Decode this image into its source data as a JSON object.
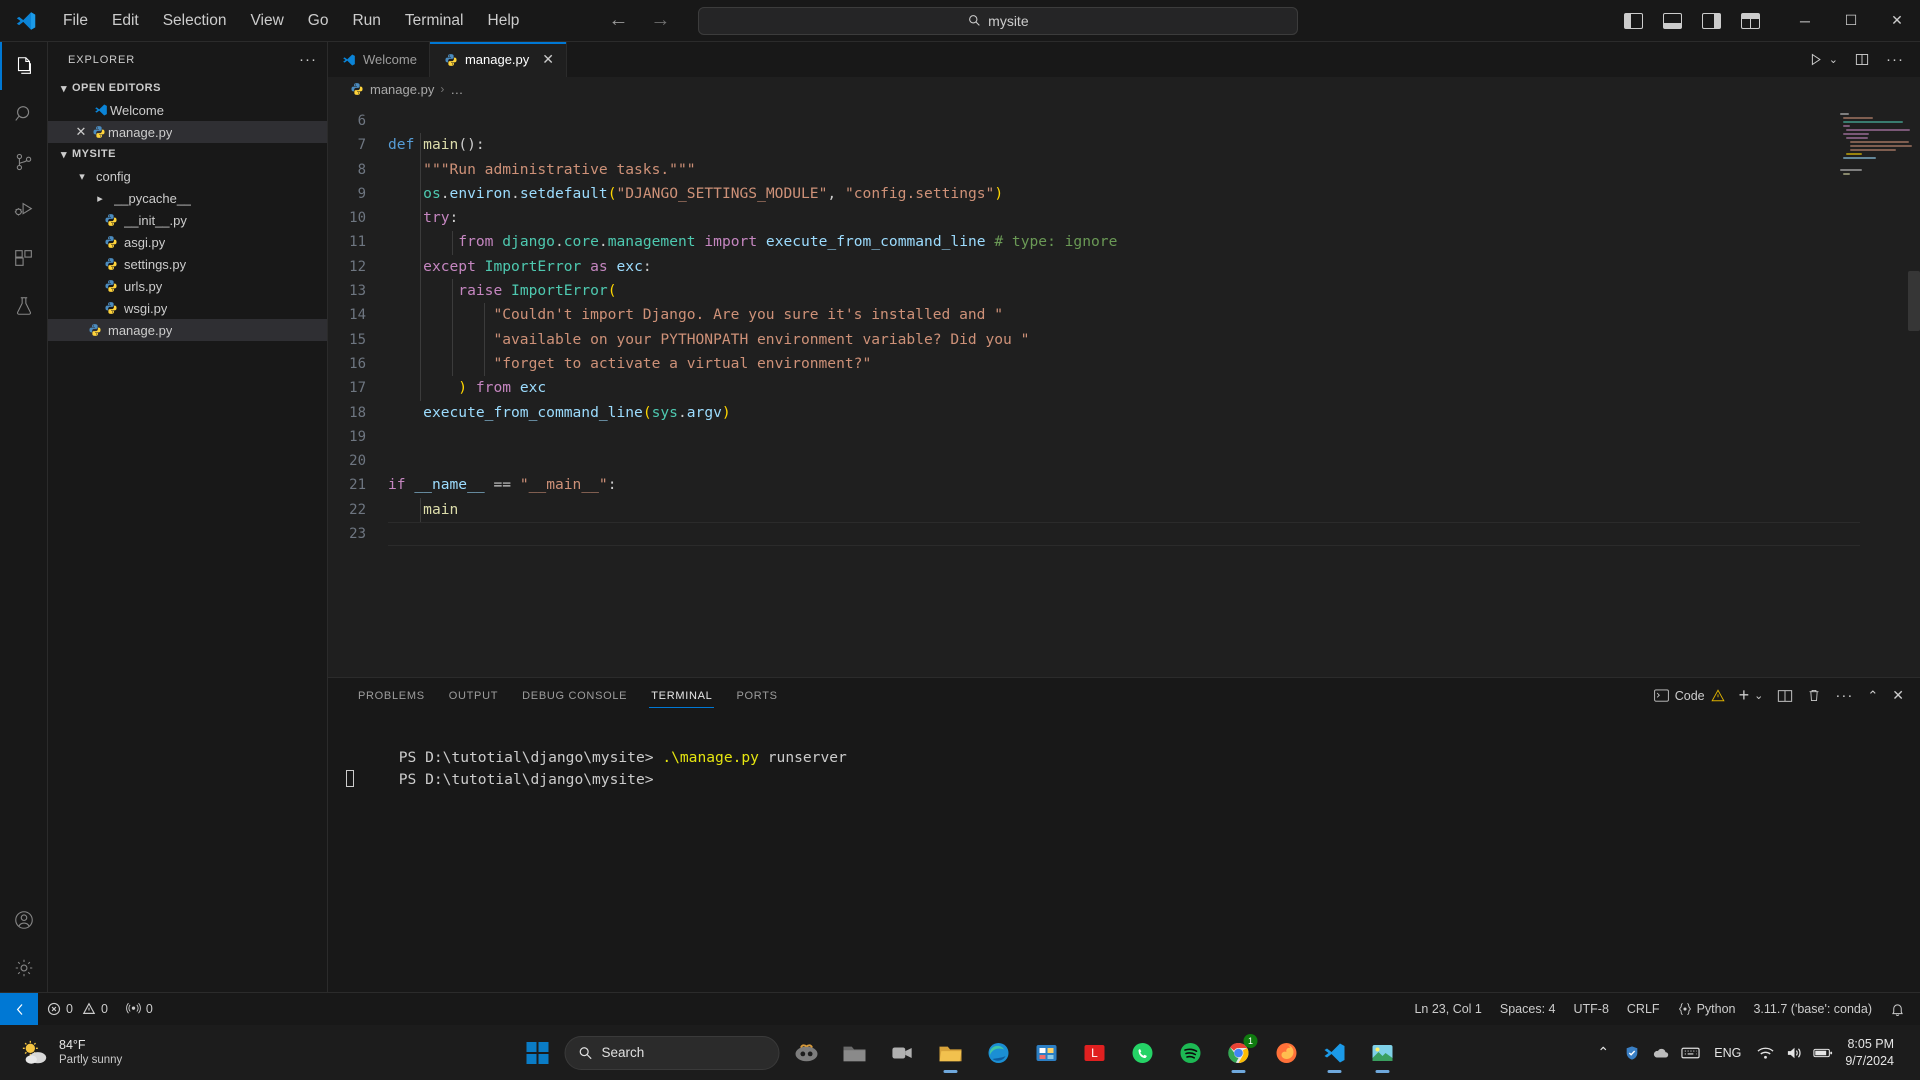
{
  "titlebar": {
    "menus": [
      "File",
      "Edit",
      "Selection",
      "View",
      "Go",
      "Run",
      "Terminal",
      "Help"
    ],
    "back_arrow": "←",
    "forward_arrow": "→",
    "search_value": "mysite",
    "search_icon": "search-icon",
    "window_controls": {
      "minimize": "─",
      "maximize": "☐",
      "close": "✕"
    }
  },
  "activitybar": {
    "items": [
      {
        "name": "explorer",
        "active": true
      },
      {
        "name": "search",
        "active": false
      },
      {
        "name": "source-control",
        "active": false
      },
      {
        "name": "run-and-debug",
        "active": false
      },
      {
        "name": "extensions",
        "active": false
      },
      {
        "name": "testing",
        "active": false
      }
    ],
    "bottom": [
      {
        "name": "accounts"
      },
      {
        "name": "manage-settings"
      }
    ]
  },
  "sidebar": {
    "title": "EXPLORER",
    "more_actions": "···",
    "open_editors": {
      "label": "OPEN EDITORS",
      "expanded": true,
      "items": [
        {
          "label": "Welcome",
          "icon": "vscode-icon",
          "selected": false,
          "has_close": false
        },
        {
          "label": "manage.py",
          "icon": "python-icon",
          "selected": true,
          "has_close": true
        }
      ]
    },
    "workspace": {
      "label": "MYSITE",
      "expanded": true,
      "items": [
        {
          "label": "config",
          "type": "folder",
          "expanded": true,
          "depth": 1
        },
        {
          "label": "__pycache__",
          "type": "folder",
          "expanded": false,
          "depth": 2
        },
        {
          "label": "__init__.py",
          "type": "python",
          "depth": 2
        },
        {
          "label": "asgi.py",
          "type": "python",
          "depth": 2
        },
        {
          "label": "settings.py",
          "type": "python",
          "depth": 2
        },
        {
          "label": "urls.py",
          "type": "python",
          "depth": 2
        },
        {
          "label": "wsgi.py",
          "type": "python",
          "depth": 2
        },
        {
          "label": "manage.py",
          "type": "python",
          "depth": 1,
          "selected": true
        }
      ]
    }
  },
  "editor": {
    "tabs": [
      {
        "label": "Welcome",
        "icon": "vscode-icon",
        "active": false,
        "closable": false
      },
      {
        "label": "manage.py",
        "icon": "python-icon",
        "active": true,
        "closable": true,
        "close": "✕"
      }
    ],
    "tab_actions": {
      "run": "run-icon",
      "run_chevron": "⌄",
      "split": "split-editor-icon",
      "more": "···"
    },
    "breadcrumb": {
      "file": "manage.py",
      "separator": "›",
      "tail": "…"
    },
    "first_line_number": 6,
    "lines": [
      {
        "n": 6,
        "tokens": []
      },
      {
        "n": 7,
        "tokens": [
          {
            "t": "def",
            "c": "kw"
          },
          {
            "t": " ",
            "c": "p"
          },
          {
            "t": "main",
            "c": "fn"
          },
          {
            "t": "():",
            "c": "p"
          }
        ]
      },
      {
        "n": 8,
        "tokens": [
          {
            "t": "    ",
            "c": "p"
          },
          {
            "t": "\"\"\"Run administrative tasks.\"\"\"",
            "c": "str"
          }
        ]
      },
      {
        "n": 9,
        "tokens": [
          {
            "t": "    ",
            "c": "p"
          },
          {
            "t": "os",
            "c": "mod"
          },
          {
            "t": ".",
            "c": "p"
          },
          {
            "t": "environ",
            "c": "var"
          },
          {
            "t": ".",
            "c": "p"
          },
          {
            "t": "setdefault",
            "c": "fn2"
          },
          {
            "t": "(",
            "c": "br1"
          },
          {
            "t": "\"DJANGO_SETTINGS_MODULE\"",
            "c": "str"
          },
          {
            "t": ", ",
            "c": "p"
          },
          {
            "t": "\"config.settings\"",
            "c": "str"
          },
          {
            "t": ")",
            "c": "br1"
          }
        ]
      },
      {
        "n": 10,
        "tokens": [
          {
            "t": "    ",
            "c": "p"
          },
          {
            "t": "try",
            "c": "kw2"
          },
          {
            "t": ":",
            "c": "p"
          }
        ]
      },
      {
        "n": 11,
        "tokens": [
          {
            "t": "        ",
            "c": "p"
          },
          {
            "t": "from",
            "c": "kw2"
          },
          {
            "t": " ",
            "c": "p"
          },
          {
            "t": "django",
            "c": "mod"
          },
          {
            "t": ".",
            "c": "p"
          },
          {
            "t": "core",
            "c": "mod"
          },
          {
            "t": ".",
            "c": "p"
          },
          {
            "t": "management",
            "c": "mod"
          },
          {
            "t": " ",
            "c": "p"
          },
          {
            "t": "import",
            "c": "kw2"
          },
          {
            "t": " ",
            "c": "p"
          },
          {
            "t": "execute_from_command_line",
            "c": "var"
          },
          {
            "t": " ",
            "c": "p"
          },
          {
            "t": "# type: ignore",
            "c": "cmt"
          }
        ]
      },
      {
        "n": 12,
        "tokens": [
          {
            "t": "    ",
            "c": "p"
          },
          {
            "t": "except",
            "c": "kw2"
          },
          {
            "t": " ",
            "c": "p"
          },
          {
            "t": "ImportError",
            "c": "cls"
          },
          {
            "t": " ",
            "c": "p"
          },
          {
            "t": "as",
            "c": "kw2"
          },
          {
            "t": " ",
            "c": "p"
          },
          {
            "t": "exc",
            "c": "var"
          },
          {
            "t": ":",
            "c": "p"
          }
        ]
      },
      {
        "n": 13,
        "tokens": [
          {
            "t": "        ",
            "c": "p"
          },
          {
            "t": "raise",
            "c": "kw2"
          },
          {
            "t": " ",
            "c": "p"
          },
          {
            "t": "ImportError",
            "c": "cls"
          },
          {
            "t": "(",
            "c": "br1"
          }
        ]
      },
      {
        "n": 14,
        "tokens": [
          {
            "t": "            ",
            "c": "p"
          },
          {
            "t": "\"Couldn't import Django. Are you sure it's installed and \"",
            "c": "str"
          }
        ]
      },
      {
        "n": 15,
        "tokens": [
          {
            "t": "            ",
            "c": "p"
          },
          {
            "t": "\"available on your PYTHONPATH environment variable? Did you \"",
            "c": "str"
          }
        ]
      },
      {
        "n": 16,
        "tokens": [
          {
            "t": "            ",
            "c": "p"
          },
          {
            "t": "\"forget to activate a virtual environment?\"",
            "c": "str"
          }
        ]
      },
      {
        "n": 17,
        "tokens": [
          {
            "t": "        ",
            "c": "p"
          },
          {
            "t": ")",
            "c": "br1"
          },
          {
            "t": " ",
            "c": "p"
          },
          {
            "t": "from",
            "c": "kw2"
          },
          {
            "t": " ",
            "c": "p"
          },
          {
            "t": "exc",
            "c": "var"
          }
        ]
      },
      {
        "n": 18,
        "tokens": [
          {
            "t": "    ",
            "c": "p"
          },
          {
            "t": "execute_from_command_line",
            "c": "var"
          },
          {
            "t": "(",
            "c": "br1"
          },
          {
            "t": "sys",
            "c": "mod"
          },
          {
            "t": ".",
            "c": "p"
          },
          {
            "t": "argv",
            "c": "var"
          },
          {
            "t": ")",
            "c": "br1"
          }
        ]
      },
      {
        "n": 19,
        "tokens": []
      },
      {
        "n": 20,
        "tokens": []
      },
      {
        "n": 21,
        "tokens": [
          {
            "t": "if",
            "c": "kw2"
          },
          {
            "t": " ",
            "c": "p"
          },
          {
            "t": "__name__",
            "c": "var"
          },
          {
            "t": " ",
            "c": "p"
          },
          {
            "t": "==",
            "c": "p"
          },
          {
            "t": " ",
            "c": "p"
          },
          {
            "t": "\"__main__\"",
            "c": "str"
          },
          {
            "t": ":",
            "c": "p"
          }
        ]
      },
      {
        "n": 22,
        "tokens": [
          {
            "t": "    ",
            "c": "p"
          },
          {
            "t": "main",
            "c": "fn"
          }
        ]
      },
      {
        "n": 23,
        "tokens": []
      }
    ]
  },
  "panel": {
    "tabs": [
      {
        "label": "PROBLEMS",
        "active": false
      },
      {
        "label": "OUTPUT",
        "active": false
      },
      {
        "label": "DEBUG CONSOLE",
        "active": false
      },
      {
        "label": "TERMINAL",
        "active": true
      },
      {
        "label": "PORTS",
        "active": false
      }
    ],
    "actions": {
      "shell_label": "Code",
      "warning_icon": "warning-icon",
      "new_terminal": "+",
      "new_chevron": "⌄",
      "split": "split-terminal-icon",
      "kill": "trash-icon",
      "more": "···",
      "maximize": "⌃",
      "close": "✕"
    },
    "terminal": {
      "lines": [
        {
          "prompt": "PS D:\\tutotial\\django\\mysite>",
          "command": " .\\manage.py",
          "args": " runserver"
        },
        {
          "prompt": "PS D:\\tutotial\\django\\mysite>",
          "command": "",
          "args": ""
        }
      ],
      "cursor": true
    }
  },
  "statusbar": {
    "remote_icon": "remote-window-icon",
    "left": [
      {
        "name": "errors",
        "icon": "error-icon",
        "value": "0"
      },
      {
        "name": "warnings",
        "icon": "warning-icon",
        "value": "0"
      },
      {
        "name": "ports",
        "icon": "ports-icon",
        "value": "0"
      }
    ],
    "right": [
      {
        "name": "cursor-position",
        "label": "Ln 23, Col 1"
      },
      {
        "name": "indentation",
        "label": "Spaces: 4"
      },
      {
        "name": "encoding",
        "label": "UTF-8"
      },
      {
        "name": "eol",
        "label": "CRLF"
      },
      {
        "name": "language-mode",
        "label": "Python",
        "icon": "python-brackets-icon"
      },
      {
        "name": "interpreter",
        "label": "3.11.7 ('base': conda)"
      },
      {
        "name": "notifications",
        "icon": "bell-icon",
        "label": ""
      }
    ]
  },
  "taskbar": {
    "weather": {
      "temperature": "84°F",
      "condition": "Partly sunny",
      "icon": "partly-sunny-icon"
    },
    "start_icon": "windows-start-icon",
    "search": {
      "placeholder": "Search",
      "icon": "search-icon"
    },
    "apps": [
      {
        "name": "copilot",
        "icon": "copilot-icon",
        "running": false
      },
      {
        "name": "file-explorer",
        "icon": "folder-icon",
        "running": false
      },
      {
        "name": "teams",
        "icon": "teams-icon",
        "running": false
      },
      {
        "name": "file-manager",
        "icon": "files-icon",
        "running": true
      },
      {
        "name": "edge",
        "icon": "edge-icon",
        "running": false
      },
      {
        "name": "store",
        "icon": "store-icon",
        "running": false
      },
      {
        "name": "lenovo",
        "icon": "lenovo-icon",
        "running": false
      },
      {
        "name": "whatsapp",
        "icon": "whatsapp-icon",
        "running": false
      },
      {
        "name": "spotify",
        "icon": "spotify-icon",
        "running": false
      },
      {
        "name": "chrome",
        "icon": "chrome-icon",
        "running": true,
        "badge": "1"
      },
      {
        "name": "firefox",
        "icon": "firefox-icon",
        "running": false
      },
      {
        "name": "vscode",
        "icon": "vscode-icon",
        "running": true
      },
      {
        "name": "photos",
        "icon": "photos-icon",
        "running": true
      }
    ],
    "tray": {
      "chevron": "⌃",
      "icons": [
        "shield-icon",
        "onedrive-icon",
        "keyboard-icon"
      ],
      "language": "ENG",
      "network_icon": "wifi-icon",
      "volume_icon": "volume-icon",
      "battery_icon": "battery-icon"
    },
    "clock": {
      "time": "8:05 PM",
      "date": "9/7/2024"
    }
  },
  "colors": {
    "accent": "#0078d4",
    "editor_bg": "#1f1f1f",
    "chrome_bg": "#181818",
    "keyword": "#569cd6",
    "keyword2": "#c586c0",
    "function": "#dcdcaa",
    "string": "#ce9178",
    "module": "#4ec9b0",
    "variable": "#9cdcfe",
    "comment": "#6a9955",
    "bracket": "#ffd700"
  }
}
